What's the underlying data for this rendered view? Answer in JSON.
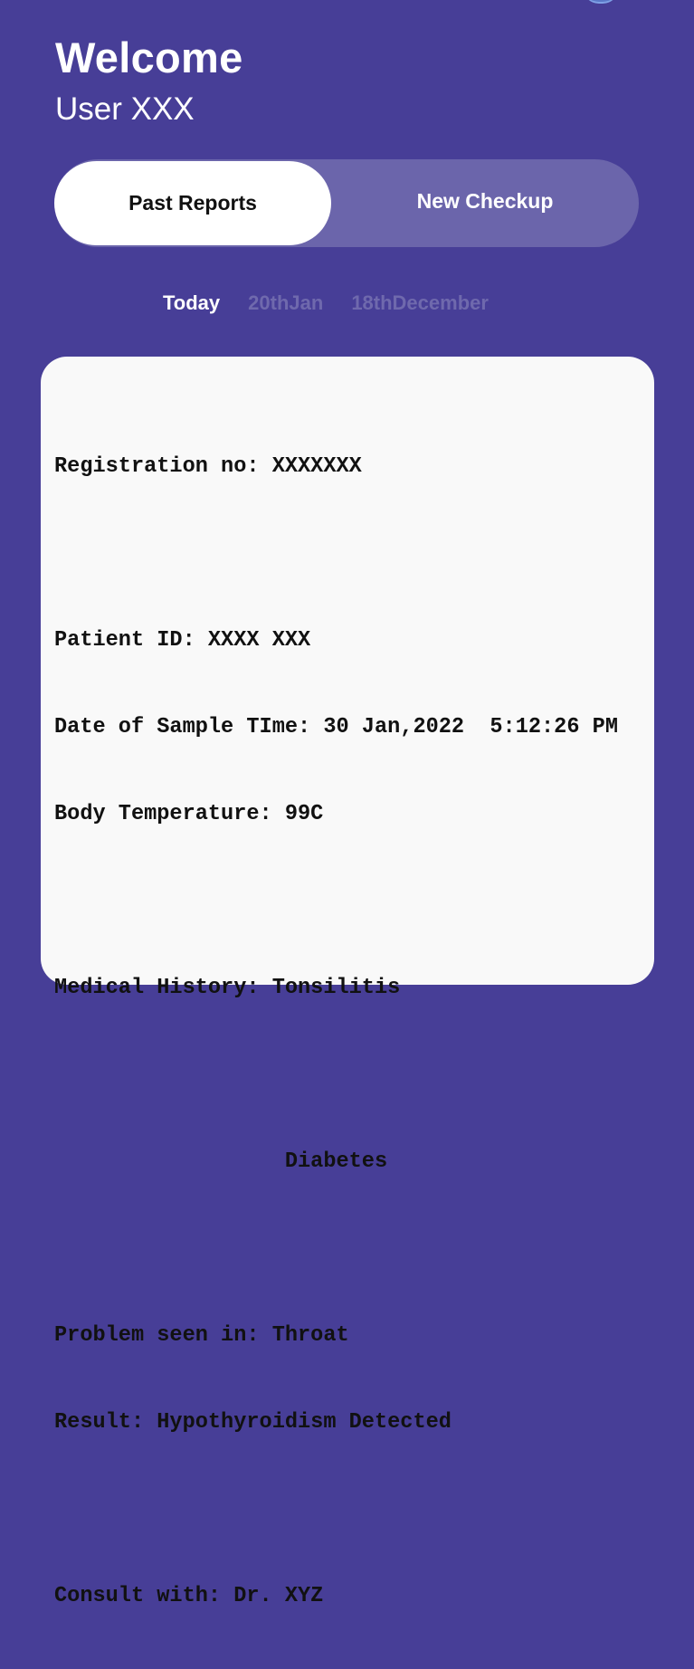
{
  "header": {
    "title": "Welcome",
    "subtitle": "User XXX"
  },
  "segmented_control": {
    "past_reports_label": "Past Reports",
    "new_checkup_label": "New Checkup",
    "selected": "Past Reports"
  },
  "date_tabs": [
    {
      "label": "Today",
      "active": true
    },
    {
      "label": "20thJan",
      "active": false
    },
    {
      "label": "18thDecember",
      "active": false
    }
  ],
  "report": {
    "registration_no": "Registration no: XXXXXXX",
    "patient_id": "Patient ID: XXXX XXX",
    "date_of_sample": "Date of Sample TIme: 30 Jan,2022  5:12:26 PM",
    "body_temperature": "Body Temperature: 99C",
    "medical_history": "Medical History: Tonsilitis",
    "medical_history_extra": "                  Diabetes",
    "problem_seen_in": "Problem seen in: Throat",
    "result": "Result: Hypothyroidism Detected",
    "consult_with": "Consult with: Dr. XYZ"
  },
  "colors": {
    "background": "#473e97",
    "segment_track": "#6b65ab",
    "card": "#f9f9f9",
    "inactive_date": "#6f69ad"
  }
}
